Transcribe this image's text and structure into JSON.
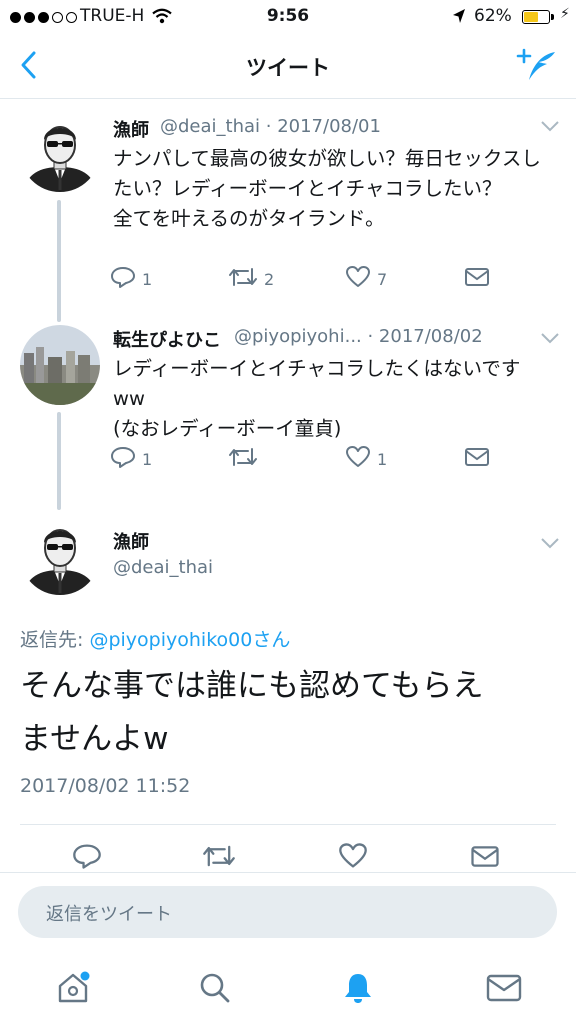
{
  "status_bar": {
    "carrier": "TRUE-H",
    "time": "9:56",
    "battery_percent": "62%",
    "battery_level": 0.62,
    "signal_bars": 3,
    "icons": [
      "signal-dots-icon",
      "wifi-icon",
      "location-arrow-icon",
      "battery-icon",
      "charging-bolt-icon"
    ]
  },
  "nav": {
    "title": "ツイート",
    "back_icon": "chevron-left-icon",
    "compose_icon": "compose-feather-icon"
  },
  "colors": {
    "accent": "#1da1f2",
    "secondary_text": "#657786",
    "thread_line": "#c9d3dc",
    "divider": "#e1e8ed"
  },
  "tweets": [
    {
      "name": "漁師",
      "meta": "@deai_thai · 2017/08/01",
      "text": "ナンパして最高の彼女が欲しい？毎日セックスしたい？レディーボーイとイチャコラしたい？\n全てを叶えるのがタイランド。",
      "reply_count": "1",
      "retweet_count": "2",
      "like_count": "7"
    },
    {
      "name": "転生ぴよひこ",
      "meta": "@piyopiyohi... · 2017/08/02",
      "text": "レディーボーイとイチャコラしたくはないですww\n(なおレディーボーイ童貞)",
      "reply_count": "1",
      "retweet_count": "",
      "like_count": "1"
    }
  ],
  "main_tweet": {
    "name": "漁師",
    "handle": "@deai_thai",
    "reply_prefix": "返信先: ",
    "reply_handle": "@piyopiyohiko00さん",
    "text": "そんな事では誰にも認めてもらえ\nませんよw",
    "timestamp": "2017/08/02 11:52"
  },
  "reply_box": {
    "placeholder": "返信をツイート"
  },
  "tab_bar": {
    "tabs": [
      "home-icon",
      "search-icon",
      "notifications-bell-icon",
      "messages-envelope-icon"
    ],
    "active": "notifications-bell-icon",
    "home_has_badge": true
  }
}
